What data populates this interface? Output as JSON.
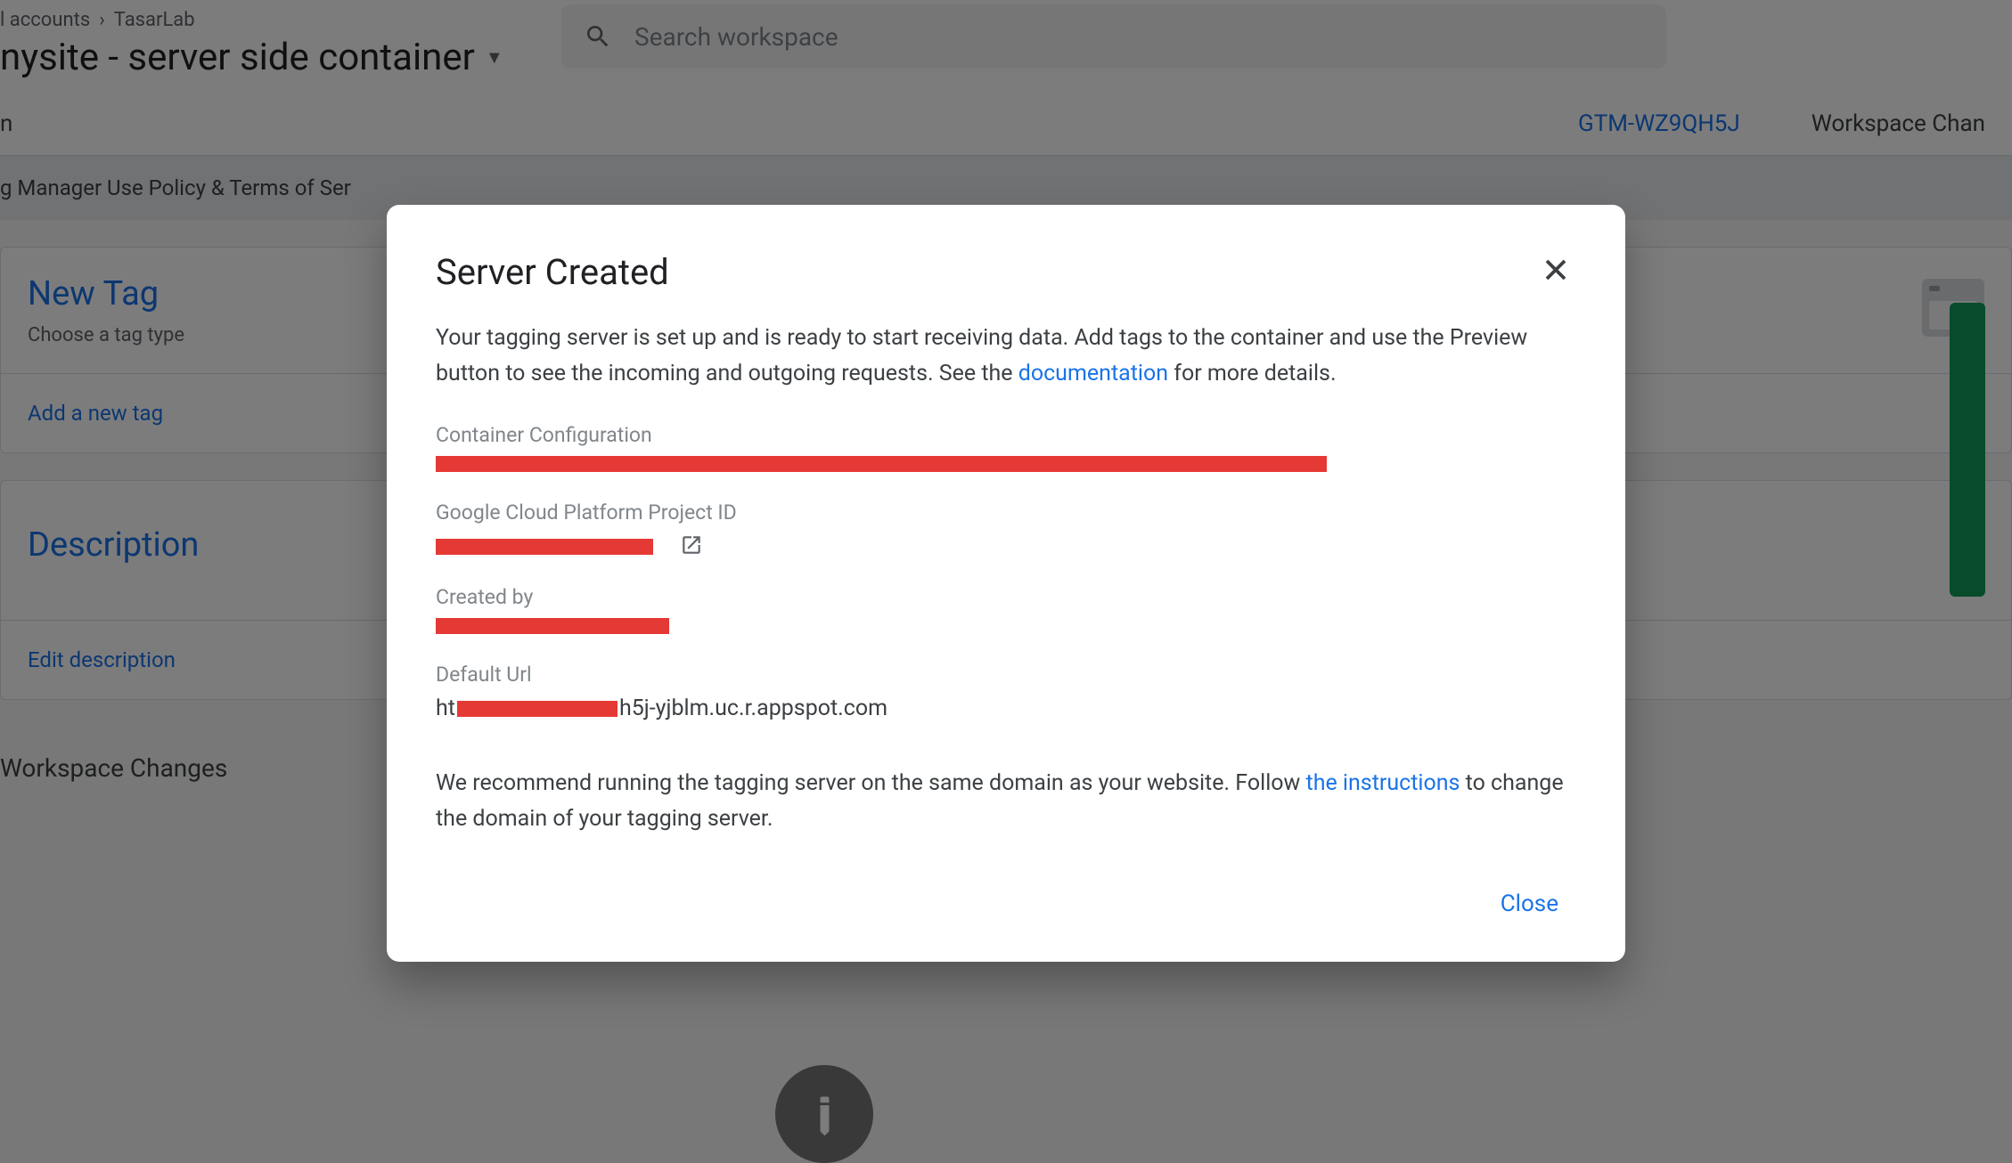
{
  "breadcrumb": {
    "accounts": "l accounts",
    "workspace": "TasarLab"
  },
  "container_title": "nysite - server side container",
  "search": {
    "placeholder": "Search workspace"
  },
  "gtm_id": "GTM-WZ9QH5J",
  "workspace_chan": "Workspace Chan",
  "policy_text": "g Manager Use Policy & Terms of Ser",
  "cards": {
    "new_tag": {
      "title": "New Tag",
      "subtitle": "Choose a tag type",
      "link": "Add a new tag"
    },
    "description": {
      "title": "Description",
      "link": "Edit description"
    }
  },
  "workspace_changes": "Workspace Changes",
  "modal": {
    "title": "Server Created",
    "description_pre": "Your tagging server is set up and is ready to start receiving data. Add tags to the container and use the Preview button to see the incoming and outgoing requests. See the ",
    "doc_link": "documentation",
    "description_post": " for more details.",
    "labels": {
      "container_config": "Container Configuration",
      "gcp_project": "Google Cloud Platform Project ID",
      "created_by": "Created by",
      "default_url": "Default Url"
    },
    "url_prefix": "ht",
    "url_suffix": "h5j-yjblm.uc.r.appspot.com",
    "recommend_pre": "We recommend running the tagging server on the same domain as your website. Follow ",
    "instructions_link": "the instructions",
    "recommend_post": " to change the domain of your tagging server.",
    "close_btn": "Close"
  }
}
